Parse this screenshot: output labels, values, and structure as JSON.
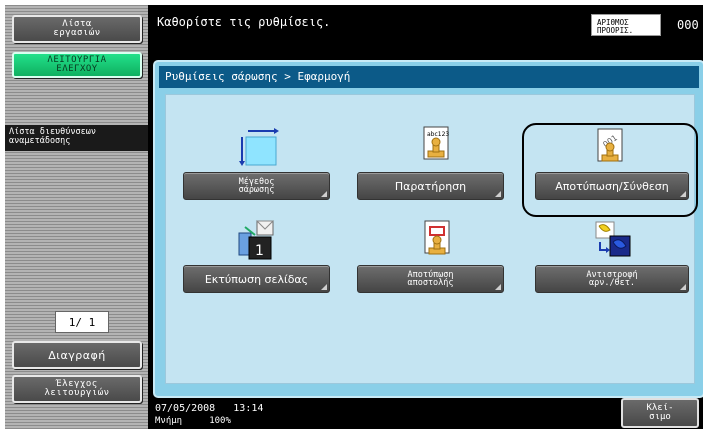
{
  "header": {
    "instruction": "Καθορίστε τις ρυθμίσεις.",
    "copies_label": "ΑΡΙΘΜΟΣ\nΠΡΟΟΡΙΣ.",
    "copies_value": "000"
  },
  "sidebar": {
    "job_list": "Λίστα\nεργασιών",
    "functions": "ΛΕΙΤΟΥΡΓΙΑ\nΕΛΕΓΧΟΥ",
    "address_list": "Λίστα διευθύνσεων\nαναμετάδοσης",
    "page_indicator": "1/  1",
    "delete": "Διαγραφή",
    "check_job": "Έλεγχος\nλειτουργιών"
  },
  "panel": {
    "breadcrumb": "Ρυθμίσεις σάρωσης > Εφαρμογή",
    "buttons": [
      {
        "label": "Μέγεθος\nσάρωσης",
        "icon": "scan-size-icon"
      },
      {
        "label": "Παρατήρηση",
        "icon": "annotation-icon"
      },
      {
        "label": "Αποτύπωση/Σύνθεση",
        "icon": "stamp-compose-icon"
      },
      {
        "label": "Εκτύπωση σελίδας",
        "icon": "page-print-icon"
      },
      {
        "label": "Αποτύπωση\nαποστολής",
        "icon": "send-stamp-icon"
      },
      {
        "label": "Αντιστροφή\nαρν./θετ.",
        "icon": "negative-positive-icon"
      }
    ],
    "annotation_icon_text": "abc123"
  },
  "footer": {
    "date": "07/05/2008",
    "time": "13:14",
    "memory_label": "Μνήμη",
    "memory_value": "100%",
    "close": "Κλεί-\nσιμο"
  },
  "colors": {
    "panel_bg": "#8acfe8",
    "title_bar": "#0c5a88",
    "active_green": "#22e08a"
  }
}
